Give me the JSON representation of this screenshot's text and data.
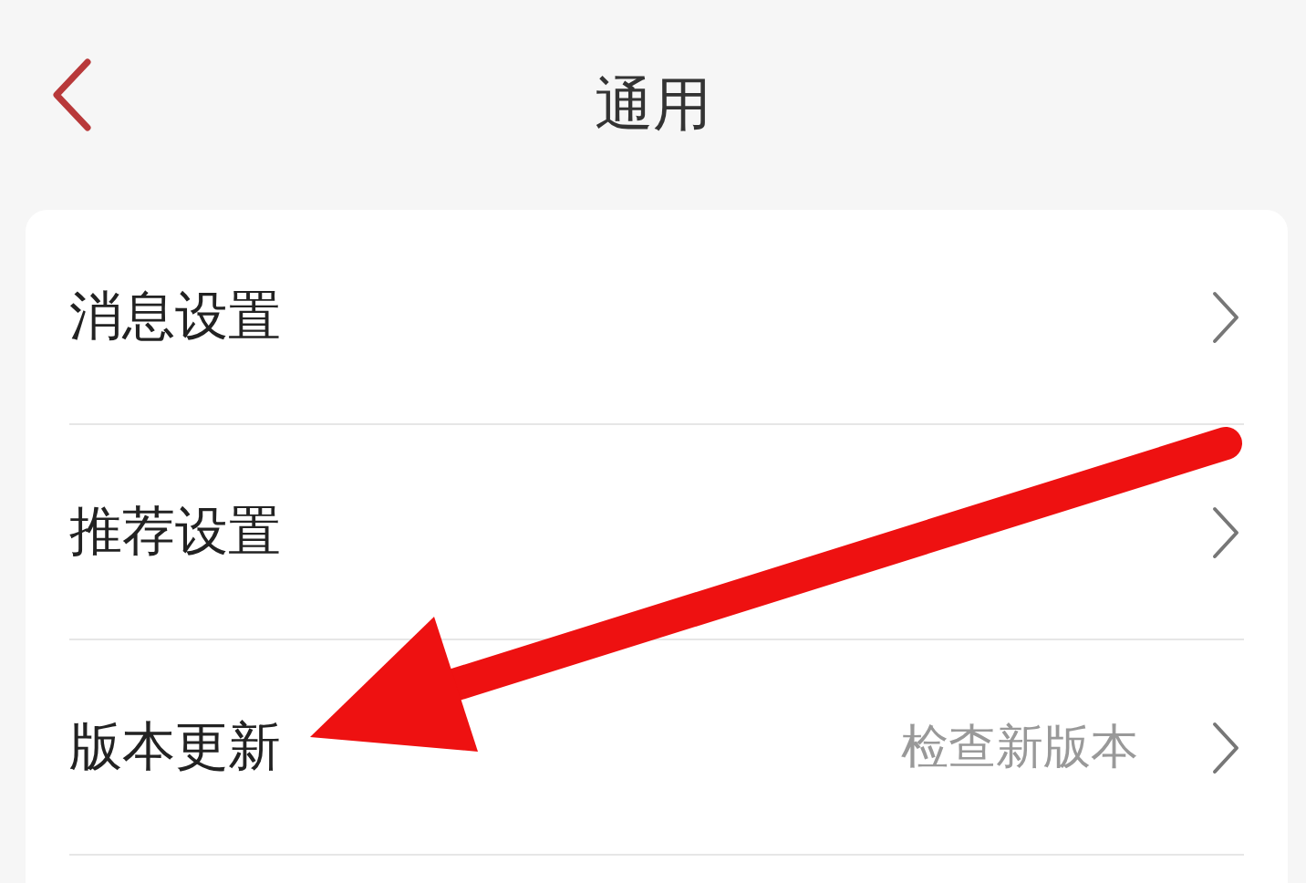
{
  "header": {
    "title": "通用"
  },
  "settings": [
    {
      "label": "消息设置"
    },
    {
      "label": "推荐设置"
    },
    {
      "label": "版本更新",
      "value": "检查新版本"
    }
  ]
}
